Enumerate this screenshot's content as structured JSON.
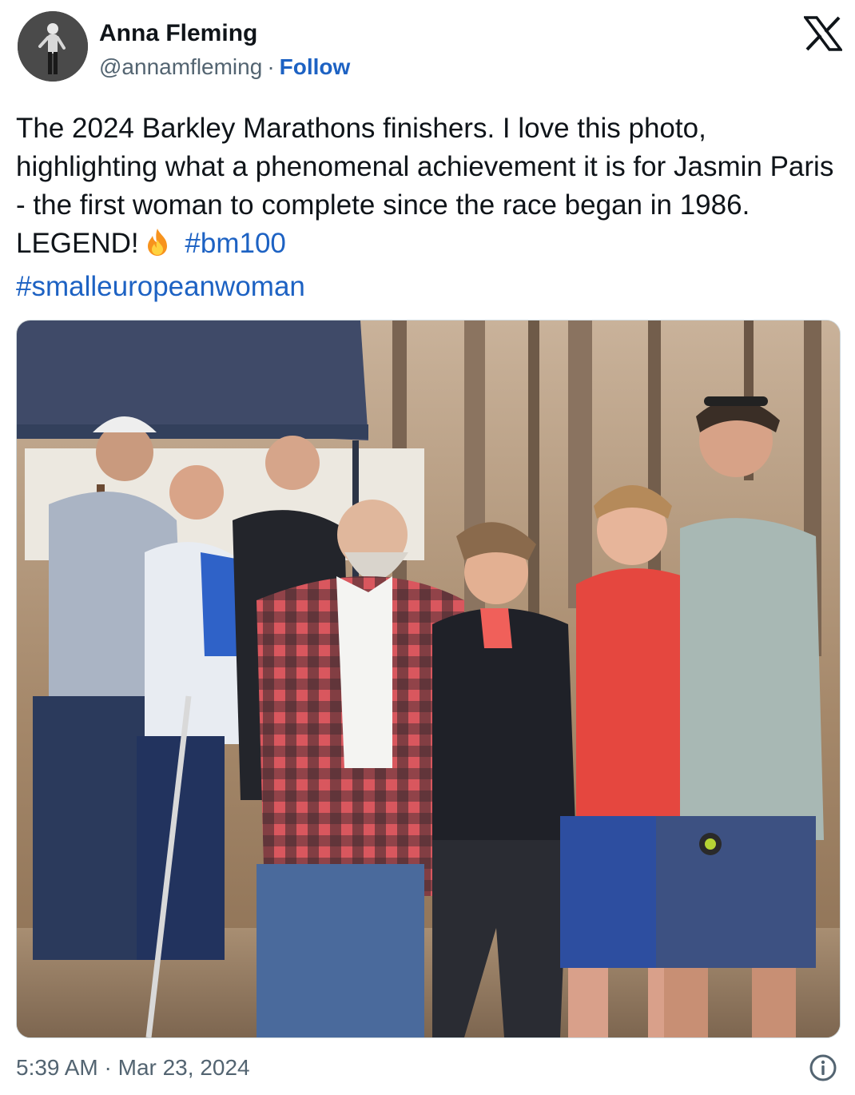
{
  "author": {
    "name": "Anna Fleming",
    "handle": "@annamfleming",
    "separator": "·",
    "follow_label": "Follow"
  },
  "tweet": {
    "text_main": "The 2024 Barkley Marathons finishers. I love this photo, highlighting what a phenomenal achievement it is for Jasmin Paris - the first woman to complete since the race began in 1986. LEGEND!",
    "emoji_icon": "fire-emoji",
    "hashtags": [
      "#bm100",
      "#smalleuropeanwoman"
    ]
  },
  "media": {
    "type": "photo"
  },
  "footer": {
    "timestamp": "5:39 AM · Mar 23, 2024"
  },
  "icons": {
    "brand": "x-logo-icon",
    "info": "info-icon"
  },
  "colors": {
    "text": "#0f1419",
    "secondary": "#536471",
    "link": "#1d62c3",
    "border": "#cfd9de"
  }
}
